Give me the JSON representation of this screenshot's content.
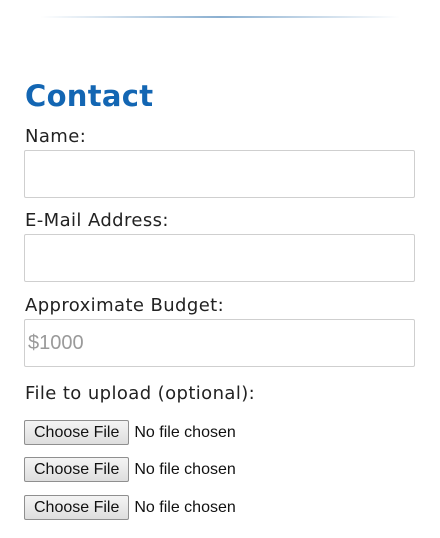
{
  "form": {
    "title": "Contact",
    "name_label": "Name:",
    "name_value": "",
    "email_label": "E-Mail Address:",
    "email_value": "",
    "budget_label": "Approximate Budget:",
    "budget_value": "",
    "budget_placeholder": "$1000",
    "upload_label": "File to upload (optional):",
    "file_inputs": [
      {
        "button_label": "Choose File",
        "status": "No file chosen"
      },
      {
        "button_label": "Choose File",
        "status": "No file chosen"
      },
      {
        "button_label": "Choose File",
        "status": "No file chosen"
      }
    ]
  },
  "colors": {
    "title": "#1366b3",
    "label": "#222222",
    "input_border": "#cfcfcf",
    "placeholder": "#9a9a9a"
  }
}
